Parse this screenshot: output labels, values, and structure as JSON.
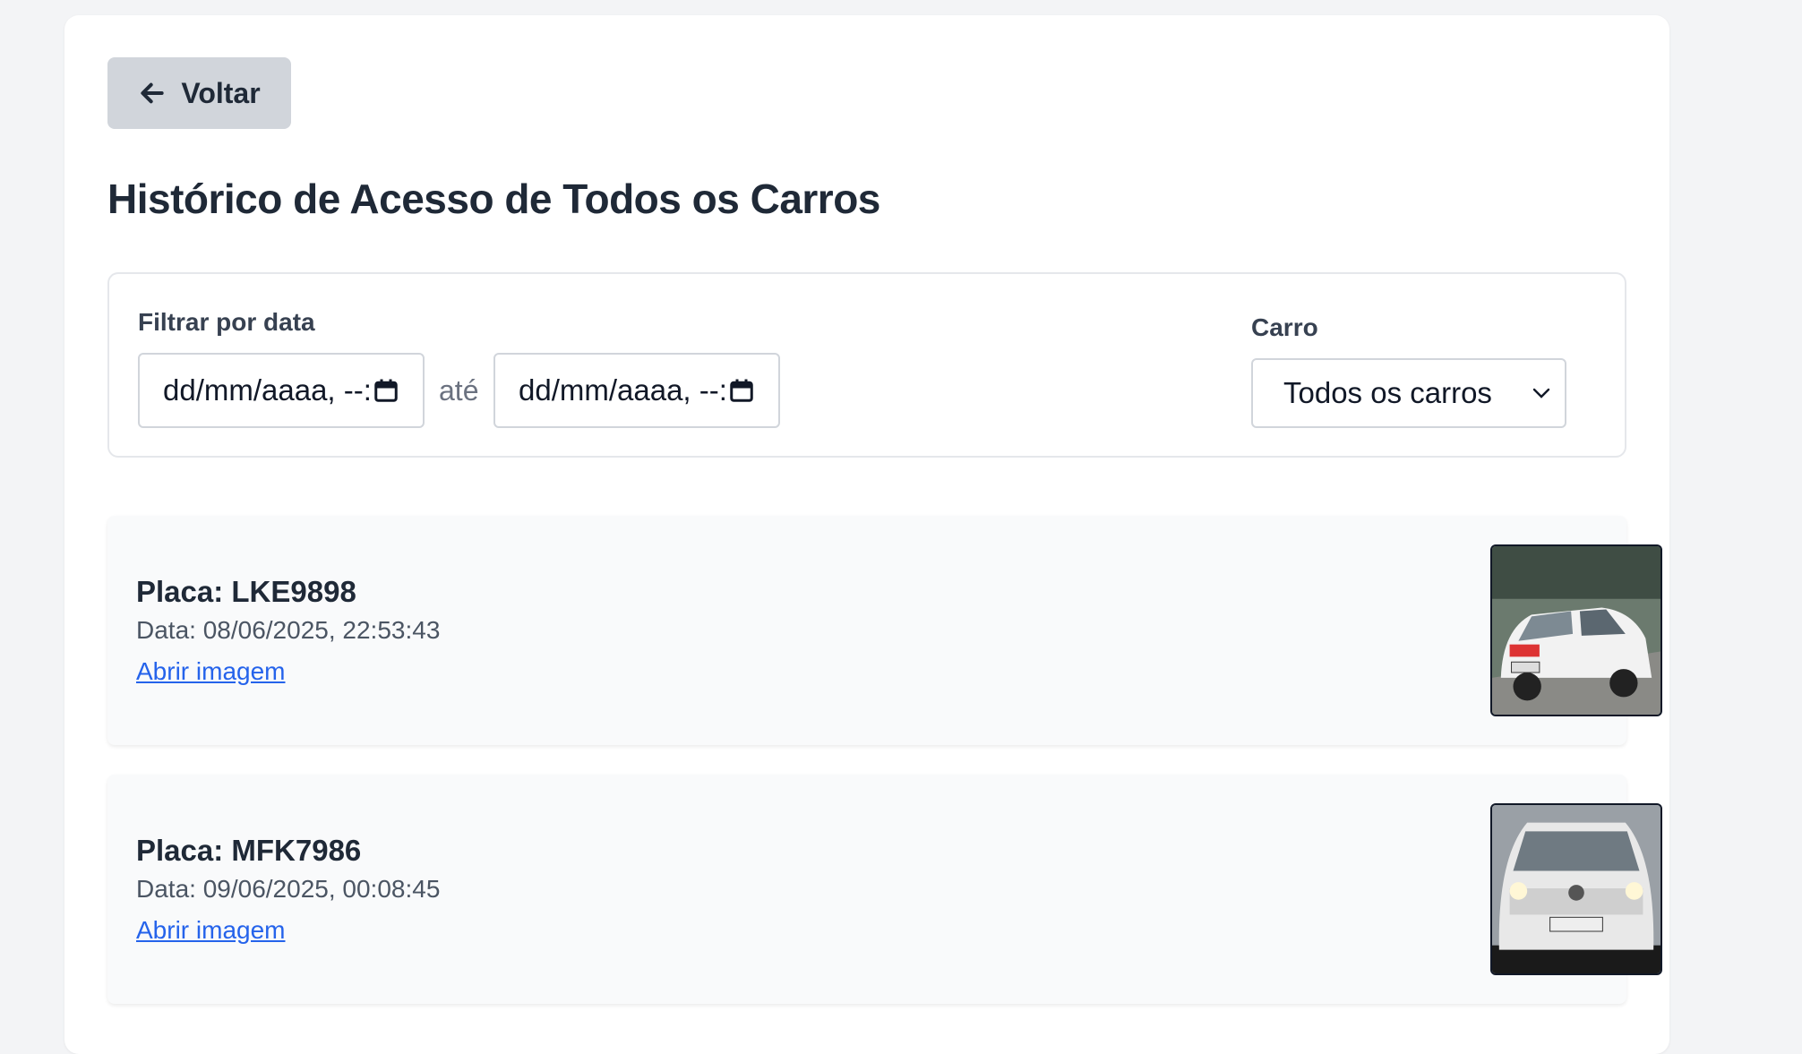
{
  "header": {
    "back_label": "Voltar",
    "title": "Histórico de Acesso de Todos os Carros"
  },
  "filter": {
    "date_label": "Filtrar por data",
    "date_from_placeholder": "dd/mm/aaaa, --:--",
    "range_separator": "até",
    "date_to_placeholder": "dd/mm/aaaa, --:--",
    "car_label": "Carro",
    "car_selected": "Todos os carros"
  },
  "records": [
    {
      "plate_text": "Placa: LKE9898",
      "date_text": "Data: 08/06/2025, 22:53:43",
      "link_label": "Abrir imagem"
    },
    {
      "plate_text": "Placa: MFK7986",
      "date_text": "Data: 09/06/2025, 00:08:45",
      "link_label": "Abrir imagem"
    }
  ],
  "icons": {
    "back": "arrow-left-icon",
    "calendar": "calendar-icon",
    "select": "chevron-down-icon"
  },
  "colors": {
    "page_bg": "#f3f4f6",
    "back_button_bg": "#d1d5db",
    "link": "#2563eb",
    "record_bg": "#f9fafb"
  }
}
